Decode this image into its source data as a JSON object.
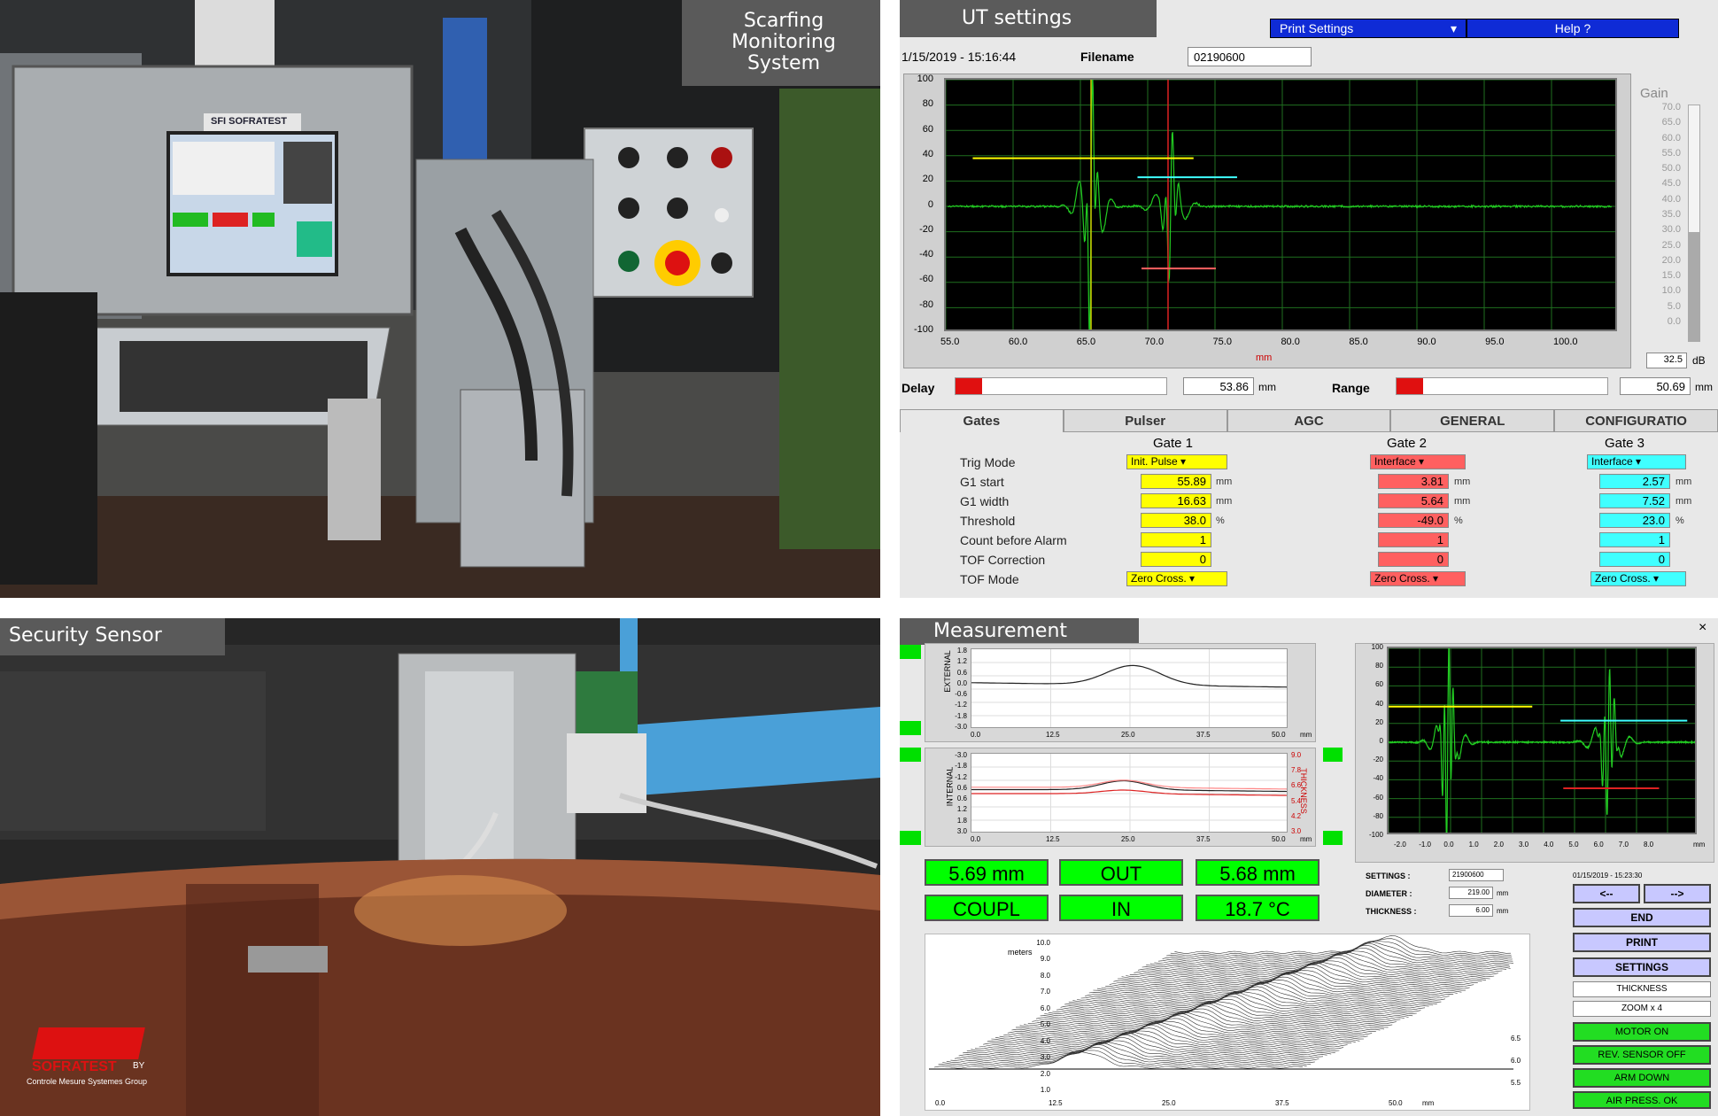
{
  "photo_scarfing": {
    "caption": "Scarfing Monitoring System",
    "brand": "SFI SOFRATEST"
  },
  "photo_security": {
    "caption": "Security Sensor",
    "logo_text": "SOFRATEST",
    "logo_by": "BY",
    "logo_group": "Controle Mesure Systemes Group"
  },
  "ut": {
    "title": "UT settings",
    "print_settings": "Print Settings",
    "help": "Help ?",
    "datetime": "1/15/2019 - 15:16:44",
    "filename_label": "Filename",
    "filename_value": "02190600",
    "y_ticks": [
      "100",
      "80",
      "60",
      "40",
      "20",
      "0",
      "-20",
      "-40",
      "-60",
      "-80",
      "-100"
    ],
    "x_ticks": [
      "55.0",
      "60.0",
      "65.0",
      "70.0",
      "75.0",
      "80.0",
      "85.0",
      "90.0",
      "95.0",
      "100.0"
    ],
    "x_unit": "mm",
    "gain_label": "Gain",
    "gain_ticks": [
      "70.0",
      "65.0",
      "60.0",
      "55.0",
      "50.0",
      "45.0",
      "40.0",
      "35.0",
      "30.0",
      "25.0",
      "20.0",
      "15.0",
      "10.0",
      "5.0",
      "0.0"
    ],
    "gain_value": "32.5",
    "gain_unit": "dB",
    "delay_label": "Delay",
    "delay_value": "53.86",
    "delay_unit": "mm",
    "range_label": "Range",
    "range_value": "50.69",
    "range_unit": "mm",
    "tabs": [
      "Gates",
      "Pulser",
      "AGC",
      "GENERAL",
      "CONFIGURATIO"
    ],
    "gate_headers": [
      "Gate 1",
      "Gate 2",
      "Gate 3"
    ],
    "row_labels": [
      "Trig Mode",
      "G1 start",
      "G1 width",
      "Threshold",
      "Count before Alarm",
      "TOF Correction",
      "TOF Mode"
    ],
    "units": [
      "mm",
      "mm",
      "%"
    ],
    "gate1": {
      "trig": "Init. Pulse",
      "start": "55.89",
      "width": "16.63",
      "threshold": "38.0",
      "count": "1",
      "tof_corr": "0",
      "tof_mode": "Zero Cross."
    },
    "gate2": {
      "trig": "Interface",
      "start": "3.81",
      "width": "5.64",
      "threshold": "-49.0",
      "count": "1",
      "tof_corr": "0",
      "tof_mode": "Zero Cross."
    },
    "gate3": {
      "trig": "Interface",
      "start": "2.57",
      "width": "7.52",
      "threshold": "23.0",
      "count": "1",
      "tof_corr": "0",
      "tof_mode": "Zero Cross."
    },
    "colors": {
      "gate1": "#ffff00",
      "gate2": "#ff6060",
      "gate3": "#40ffff",
      "signal": "#22cc22"
    }
  },
  "meas": {
    "title": "Measurement",
    "close": "×",
    "external_label": "EXTERNAL",
    "internal_label": "INTERNAL",
    "thickness_label": "THICKNESS",
    "ext_y_ticks": [
      "1.8",
      "1.2",
      "0.6",
      "0.0",
      "-0.6",
      "-1.2",
      "-1.8",
      "-3.0"
    ],
    "int_y_ticks": [
      "-3.0",
      "-1.8",
      "-1.2",
      "0.6",
      "0.6",
      "1.2",
      "1.8",
      "3.0"
    ],
    "thick_ticks": [
      "9.0",
      "7.8",
      "6.6",
      "5.4",
      "4.2",
      "3.0"
    ],
    "x_ticks": [
      "0.0",
      "12.5",
      "25.0",
      "37.5",
      "50.0"
    ],
    "x_unit": "mm",
    "scope_y_ticks": [
      "100",
      "80",
      "60",
      "40",
      "20",
      "0",
      "-20",
      "-40",
      "-60",
      "-80",
      "-100"
    ],
    "scope_x_ticks": [
      "-2.0",
      "-1.0",
      "0.0",
      "1.0",
      "2.0",
      "3.0",
      "4.0",
      "5.0",
      "6.0",
      "7.0",
      "8.0"
    ],
    "scope_x_unit": "mm",
    "readouts": [
      "5.69 mm",
      "OUT",
      "5.68 mm",
      "COUPL",
      "IN",
      "18.7 °C"
    ],
    "settings_label": "SETTINGS :",
    "settings_value": "21900600",
    "diameter_label": "DIAMETER :",
    "diameter_value": "219.00",
    "diameter_unit": "mm",
    "thickness_label2": "THICKNESS :",
    "thickness_value": "6.00",
    "thickness_unit": "mm",
    "datetime": "01/15/2019 - 15:23:30",
    "nav_prev": "<--",
    "nav_next": "-->",
    "buttons": [
      "END",
      "PRINT",
      "SETTINGS"
    ],
    "selectors": [
      "THICKNESS",
      "ZOOM x 4"
    ],
    "status": [
      "MOTOR ON",
      "REV. SENSOR OFF",
      "ARM DOWN",
      "AIR PRESS. OK"
    ],
    "wf_axis_label": "meters",
    "wf_y_ticks": [
      "10.0",
      "9.0",
      "8.0",
      "7.0",
      "6.0",
      "5.0",
      "4.0",
      "3.0",
      "2.0",
      "1.0"
    ],
    "wf_right_ticks": [
      "6.5",
      "6.0",
      "5.5"
    ],
    "wf_x_ticks": [
      "0.0",
      "12.5",
      "25.0",
      "37.5",
      "50.0"
    ],
    "wf_x_unit": "mm"
  }
}
